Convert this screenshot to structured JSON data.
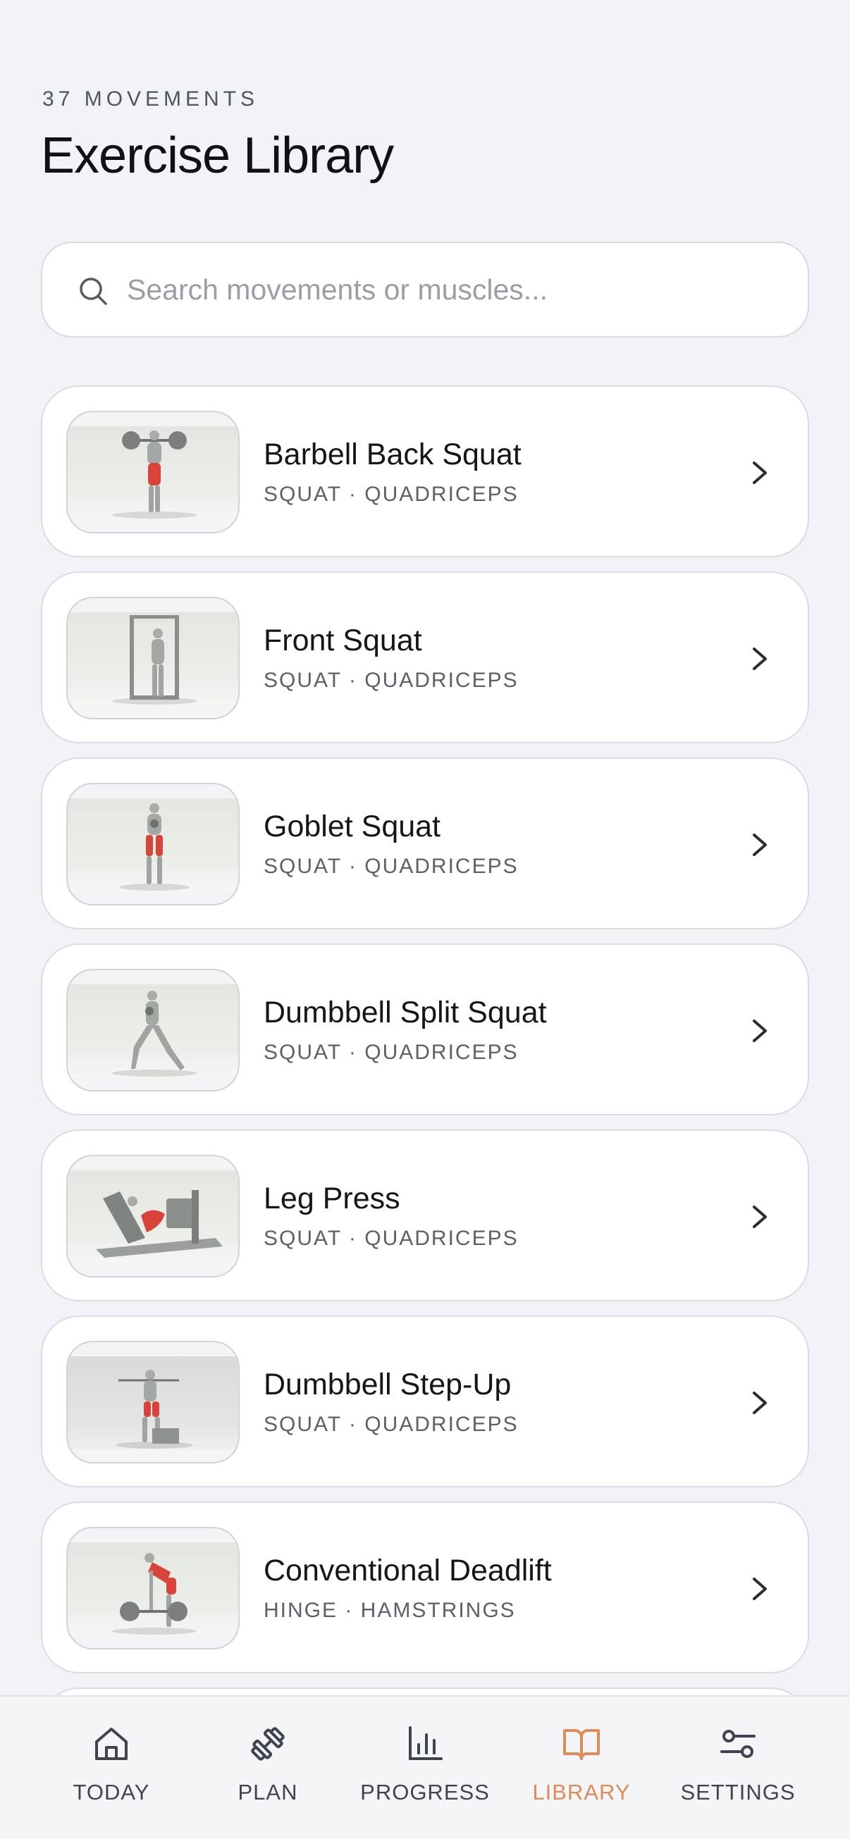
{
  "header": {
    "count_label": "37 MOVEMENTS",
    "title": "Exercise Library"
  },
  "search": {
    "placeholder": "Search movements or muscles...",
    "value": ""
  },
  "exercises": [
    {
      "name": "Barbell Back Squat",
      "meta": "SQUAT · QUADRICEPS"
    },
    {
      "name": "Front Squat",
      "meta": "SQUAT · QUADRICEPS"
    },
    {
      "name": "Goblet Squat",
      "meta": "SQUAT · QUADRICEPS"
    },
    {
      "name": "Dumbbell Split Squat",
      "meta": "SQUAT · QUADRICEPS"
    },
    {
      "name": "Leg Press",
      "meta": "SQUAT · QUADRICEPS"
    },
    {
      "name": "Dumbbell Step-Up",
      "meta": "SQUAT · QUADRICEPS"
    },
    {
      "name": "Conventional Deadlift",
      "meta": "HINGE · HAMSTRINGS"
    }
  ],
  "tabbar": {
    "items": [
      {
        "label": "TODAY",
        "icon": "home-icon"
      },
      {
        "label": "PLAN",
        "icon": "dumbbell-icon"
      },
      {
        "label": "PROGRESS",
        "icon": "bar-chart-icon"
      },
      {
        "label": "LIBRARY",
        "icon": "book-open-icon"
      },
      {
        "label": "SETTINGS",
        "icon": "sliders-icon"
      }
    ],
    "active": "LIBRARY"
  },
  "colors": {
    "accent": "#e08a57",
    "background": "#f2f3f6",
    "muscle_highlight": "#d9443a"
  }
}
